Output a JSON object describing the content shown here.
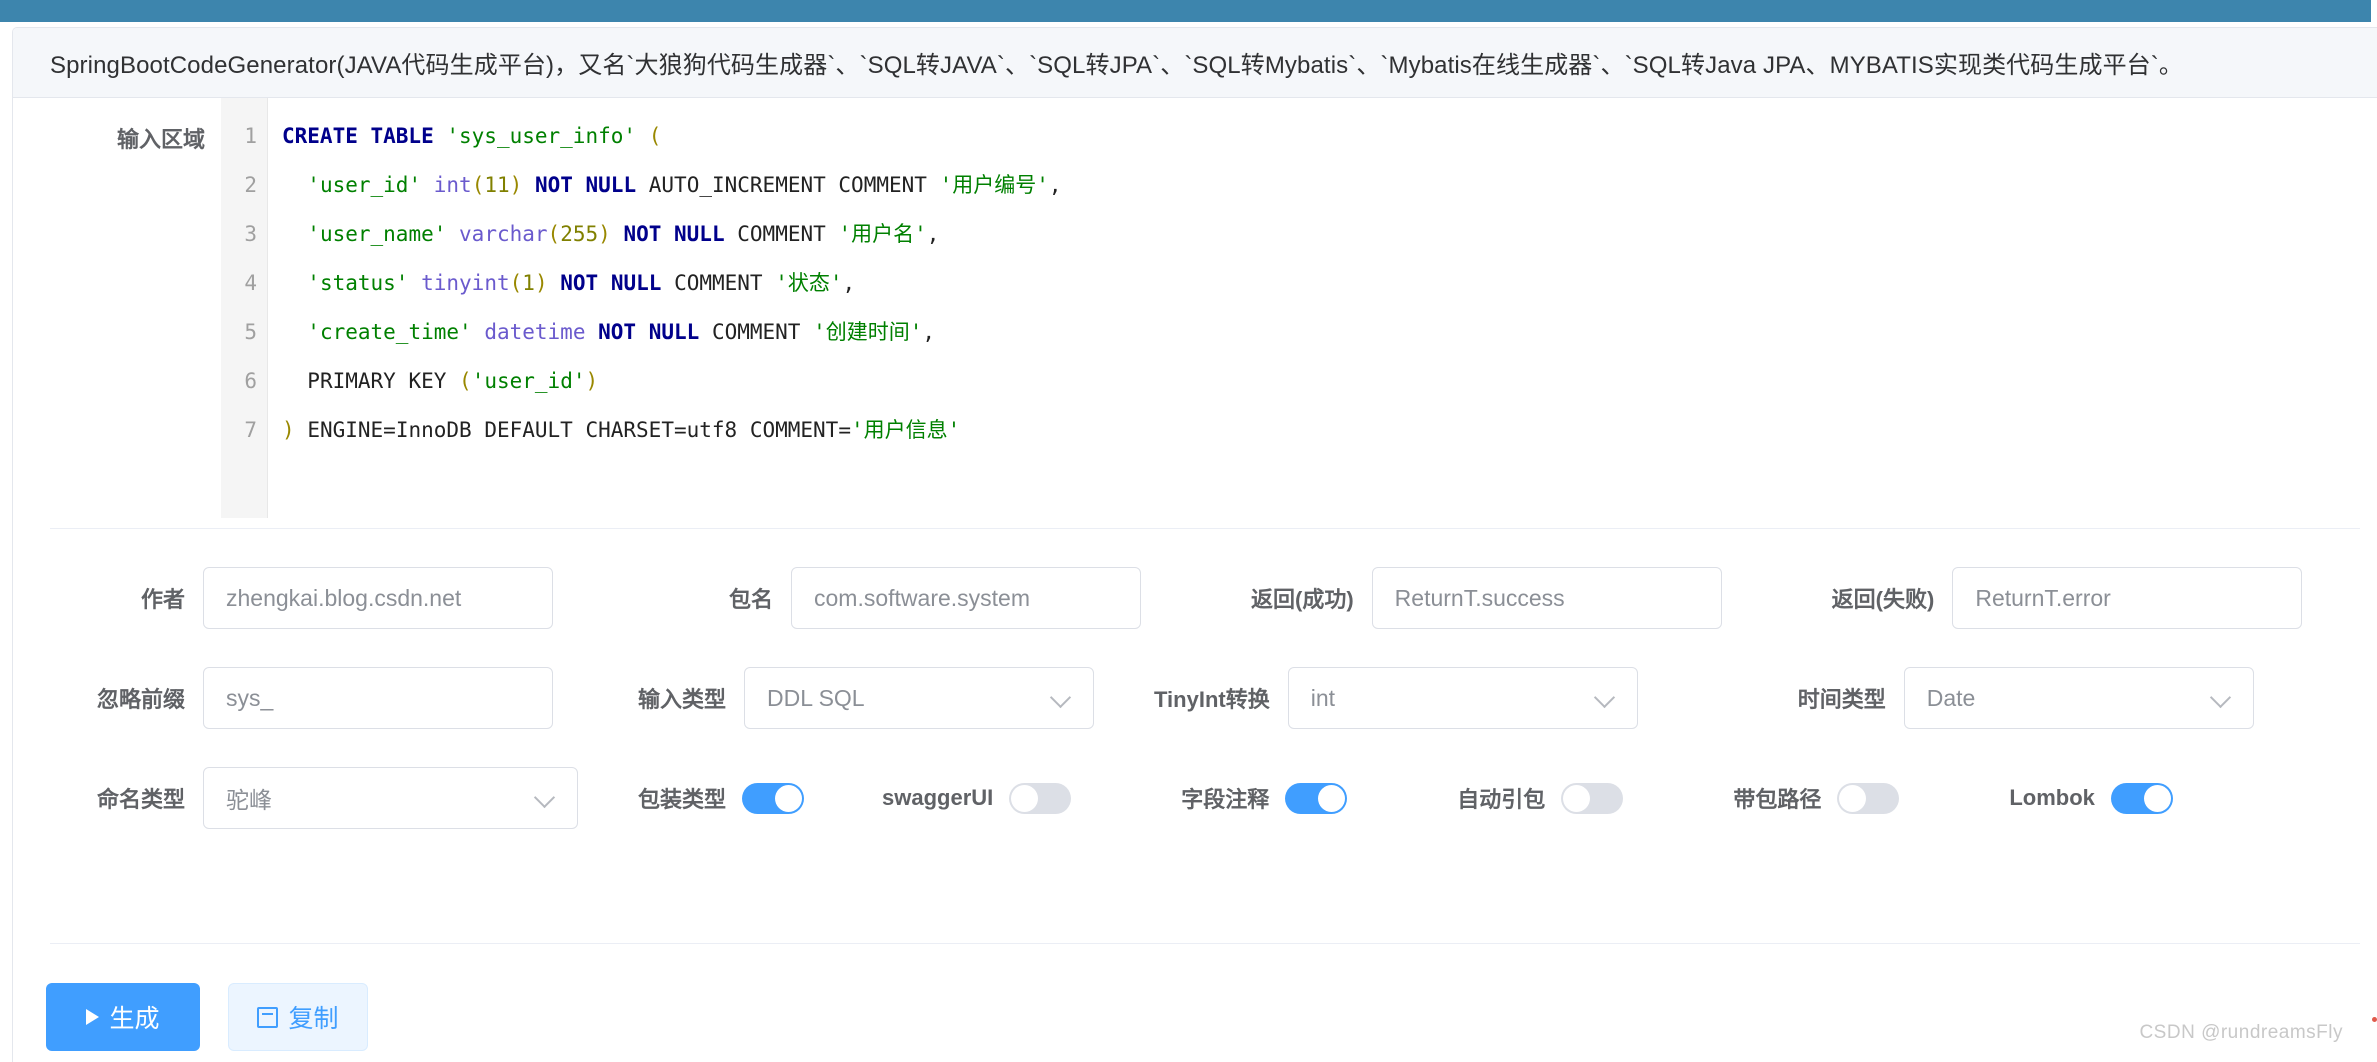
{
  "window": {
    "top_bar_color": "#3d85ad",
    "accent_color": "#409eff"
  },
  "header": {
    "title": "SpringBootCodeGenerator(JAVA代码生成平台)，又名`大狼狗代码生成器`、`SQL转JAVA`、`SQL转JPA`、`SQL转Mybatis`、`Mybatis在线生成器`、`SQL转Java JPA、MYBATIS实现类代码生成平台`。"
  },
  "editor": {
    "label": "输入区域",
    "line_numbers": [
      "1",
      "2",
      "3",
      "4",
      "5",
      "6",
      "7"
    ],
    "lines": [
      "CREATE TABLE 'sys_user_info' (",
      "  'user_id' int(11) NOT NULL AUTO_INCREMENT COMMENT '用户编号',",
      "  'user_name' varchar(255) NOT NULL COMMENT '用户名',",
      "  'status' tinyint(1) NOT NULL COMMENT '状态',",
      "  'create_time' datetime NOT NULL COMMENT '创建时间',",
      "  PRIMARY KEY ('user_id')",
      ") ENGINE=InnoDB DEFAULT CHARSET=utf8 COMMENT='用户信息'"
    ],
    "syntax_colors": {
      "keyword": "#00008b",
      "string": "#008000",
      "type": "#6a5acd",
      "number": "#808000",
      "paren": "#998800",
      "plain": "#222222"
    }
  },
  "form": {
    "author": {
      "label": "作者",
      "value": "zhengkai.blog.csdn.net"
    },
    "package": {
      "label": "包名",
      "value": "com.software.system"
    },
    "return_success": {
      "label": "返回(成功)",
      "value": "ReturnT.success"
    },
    "return_error": {
      "label": "返回(失败)",
      "value": "ReturnT.error"
    },
    "ignore_prefix": {
      "label": "忽略前缀",
      "value": "sys_"
    },
    "input_type": {
      "label": "输入类型",
      "value": "DDL SQL"
    },
    "tinyint_convert": {
      "label": "TinyInt转换",
      "value": "int"
    },
    "time_type": {
      "label": "时间类型",
      "value": "Date"
    },
    "naming_type": {
      "label": "命名类型",
      "value": "驼峰"
    }
  },
  "switches": [
    {
      "label": "包装类型",
      "on": true
    },
    {
      "label": "swaggerUI",
      "on": false
    },
    {
      "label": "字段注释",
      "on": true
    },
    {
      "label": "自动引包",
      "on": false
    },
    {
      "label": "带包路径",
      "on": false
    },
    {
      "label": "Lombok",
      "on": true
    }
  ],
  "footer": {
    "generate_label": "生成",
    "copy_label": "复制"
  },
  "watermark": "CSDN @rundreamsFly"
}
